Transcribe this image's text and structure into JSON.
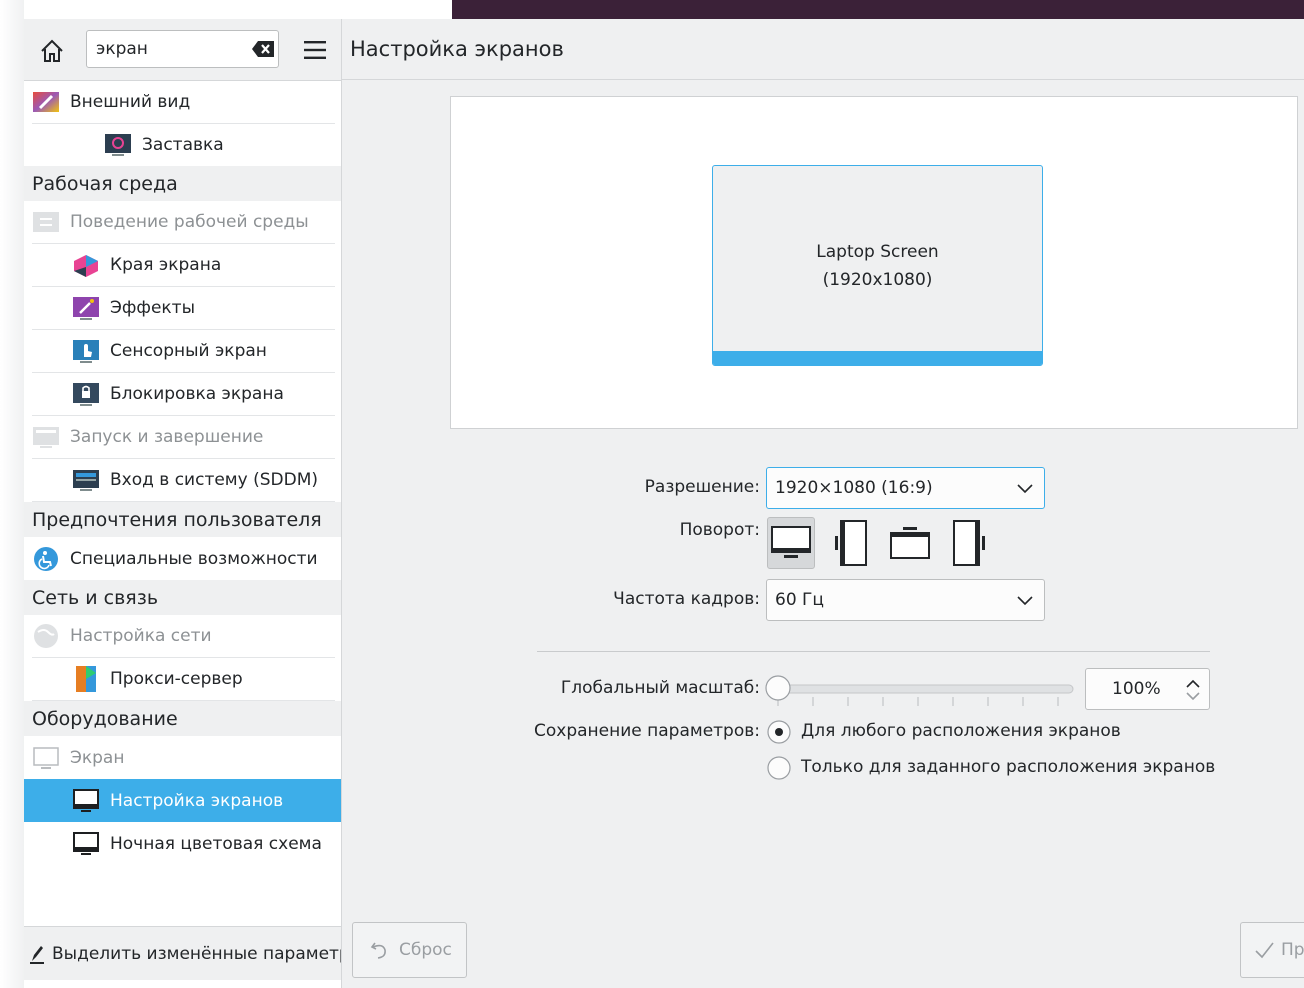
{
  "search": {
    "value": "экран"
  },
  "main": {
    "title": "Настройка экранов"
  },
  "nav": {
    "appearance": "Внешний вид",
    "screensaver": "Заставка",
    "cat_workspace": "Рабочая среда",
    "workspace_behavior": "Поведение рабочей среды",
    "screen_edges": "Края экрана",
    "effects": "Эффекты",
    "touchscreen": "Сенсорный экран",
    "screen_lock": "Блокировка экрана",
    "startup_shutdown": "Запуск и завершение",
    "login_sddm": "Вход в систему (SDDM)",
    "cat_user_prefs": "Предпочтения пользователя",
    "accessibility": "Специальные возможности",
    "cat_network": "Сеть и связь",
    "network_settings": "Настройка сети",
    "proxy": "Прокси-сервер",
    "cat_hardware": "Оборудование",
    "display": "Экран",
    "display_config": "Настройка экранов",
    "night_color": "Ночная цветовая схема"
  },
  "footer": {
    "highlight_changed": "Выделить изменённые параметры"
  },
  "monitor": {
    "name": "Laptop Screen",
    "resolution": "(1920x1080)"
  },
  "form": {
    "resolution_label": "Разрешение:",
    "resolution_value": "1920×1080 (16:9)",
    "rotation_label": "Поворот:",
    "refresh_label": "Частота кадров:",
    "refresh_value": "60 Гц",
    "scale_label": "Глобальный масштаб:",
    "scale_value": "100%",
    "scale_level": 0,
    "save_label": "Сохранение параметров:",
    "save_option_any": "Для любого расположения экранов",
    "save_option_specific": "Только для заданного расположения экранов",
    "save_selected": "any"
  },
  "buttons": {
    "reset": "Сброс",
    "apply": "Применить"
  },
  "colors": {
    "accent": "#3daee9",
    "titlebar": "#3b2138",
    "background": "#eff0f1"
  },
  "icons": {
    "home": "home-icon",
    "clear": "backspace-clear-icon",
    "menu": "hamburger-menu-icon",
    "reset": "undo-icon",
    "apply": "checkmark-icon",
    "footer": "pencil-icon"
  }
}
